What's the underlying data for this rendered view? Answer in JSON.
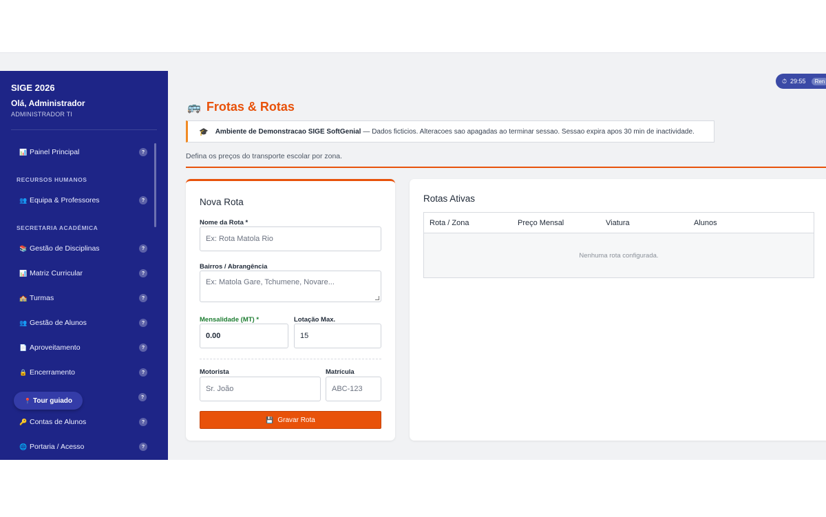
{
  "sidebar": {
    "brand": "SIGE 2026",
    "greeting": "Olá, Administrador",
    "role": "ADMINISTRADOR TI",
    "help_glyph": "?",
    "sections": {
      "hr": "RECURSOS HUMANOS",
      "academic": "SECRETARIA ACADÉMICA"
    },
    "items": {
      "dashboard": "Painel Principal",
      "team": "Equipa & Professores",
      "subjects": "Gestão de Disciplinas",
      "curriculum": "Matriz Curricular",
      "classes": "Turmas",
      "students": "Gestão de Alunos",
      "grades": "Aproveitamento",
      "closing": "Encerramento",
      "accounts": "Contas de Alunos",
      "gate": "Portaria / Acesso"
    },
    "tour": "Tour guiado"
  },
  "timer": {
    "time": "29:55",
    "renew": "Ren"
  },
  "page": {
    "title": "Frotas & Rotas",
    "demo_bold": "Ambiente de Demonstracao SIGE SoftGenial",
    "demo_text": "— Dados ficticios. Alteracoes sao apagadas ao terminar sessao. Sessao expira apos 30 min de inactividade.",
    "subtitle": "Defina os preços do transporte escolar por zona."
  },
  "form": {
    "title": "Nova Rota",
    "route_name_label": "Nome da Rota *",
    "route_name_placeholder": "Ex: Rota Matola Rio",
    "districts_label": "Bairros / Abrangência",
    "districts_placeholder": "Ex: Matola Gare, Tchumene, Novare...",
    "fee_label": "Mensalidade (MT) *",
    "fee_value": "0.00",
    "capacity_label": "Lotação Max.",
    "capacity_value": "15",
    "driver_label": "Motorista",
    "driver_placeholder": "Sr. João",
    "plate_label": "Matrícula",
    "plate_placeholder": "ABC-123",
    "save_label": "Gravar Rota"
  },
  "list": {
    "title": "Rotas Ativas",
    "columns": [
      "Rota / Zona",
      "Preço Mensal",
      "Viatura",
      "Alunos"
    ],
    "empty": "Nenhuma rota configurada."
  },
  "colors": {
    "sidebar": "#1e2587",
    "accent": "#e8520a",
    "success": "#1e7d32"
  }
}
